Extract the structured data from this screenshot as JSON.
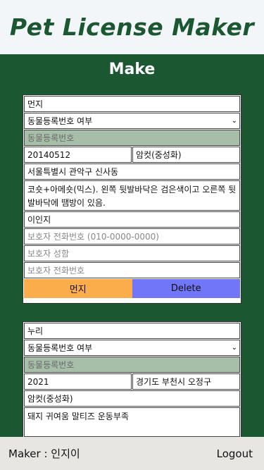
{
  "header": {
    "logo_text": "Pet License Maker"
  },
  "section_title": "Make",
  "cards": [
    {
      "name": "먼지",
      "registration_select": "동물등록번호 여부",
      "registration_placeholder": "동물등록번호",
      "birth": "20140512",
      "gender": "암컷(중성화)",
      "address": "서울특별시 관악구 신사동",
      "description": "코숏+아메숏(믹스). 왼쪽 뒷발바닥은 검은색이고 오른쪽 뒷발바닥에 땜방이 있음.",
      "guardian_name": "이인지",
      "guardian_phone_placeholder": "보호자 전화번호 (010-0000-0000)",
      "guardian_name2_placeholder": "보호자 성함",
      "guardian_phone2_placeholder": "보호자 전화번호",
      "name_button": "먼지",
      "delete_button": "Delete"
    },
    {
      "name": "누리",
      "registration_select": "동물등록번호 여부",
      "registration_placeholder": "동물등록번호",
      "birth": "2021",
      "address": "경기도 부천시 오정구",
      "gender": "암컷(중성화)",
      "description": "돼지 귀여움 말티즈 운동부족"
    }
  ],
  "footer": {
    "maker_label": "Maker : 인지이",
    "logout_label": "Logout"
  }
}
